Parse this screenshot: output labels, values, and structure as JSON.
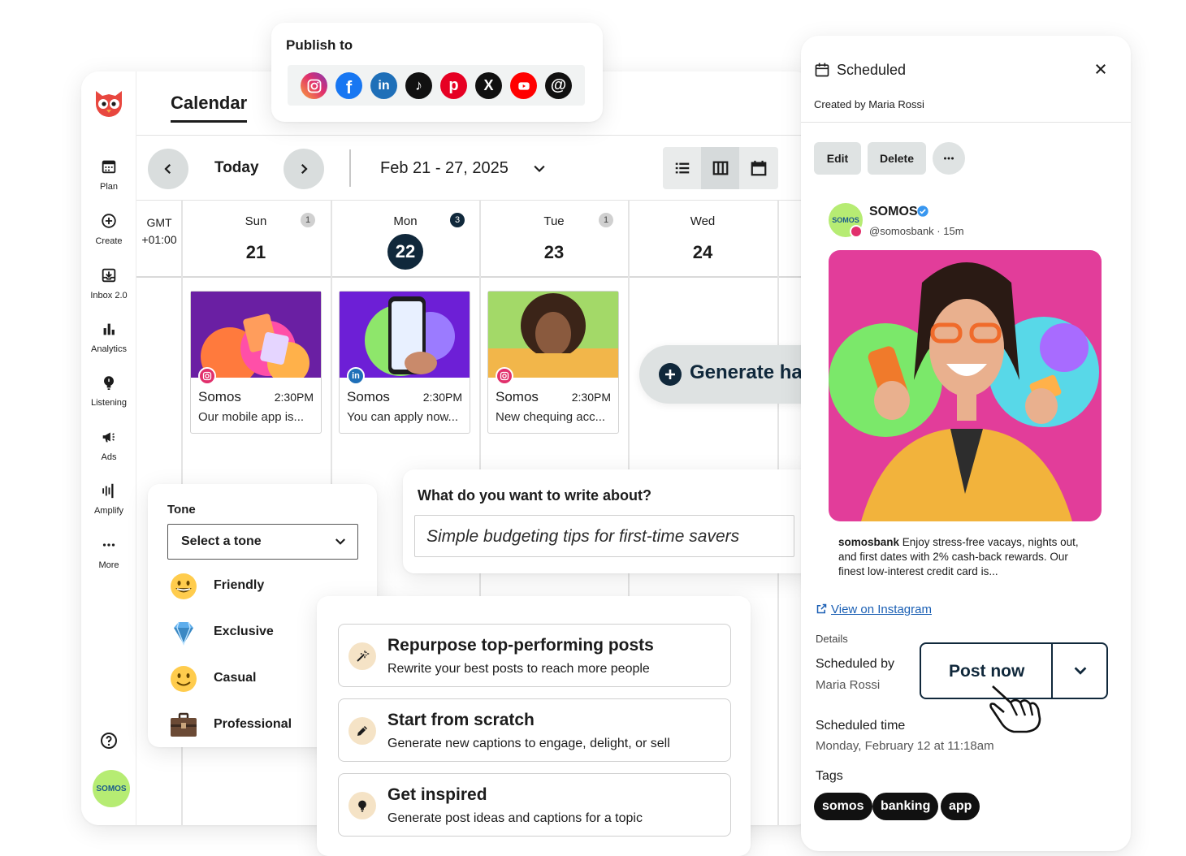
{
  "app": {
    "sidebar": {
      "items": [
        {
          "label": "Plan",
          "icon": "calendar-icon"
        },
        {
          "label": "Create",
          "icon": "plus-circle-icon"
        },
        {
          "label": "Inbox 2.0",
          "icon": "inbox-icon"
        },
        {
          "label": "Analytics",
          "icon": "bar-chart-icon"
        },
        {
          "label": "Listening",
          "icon": "lightbulb-icon"
        },
        {
          "label": "Ads",
          "icon": "megaphone-icon"
        },
        {
          "label": "Amplify",
          "icon": "amplify-icon"
        },
        {
          "label": "More",
          "icon": "more-dots-icon"
        }
      ],
      "avatar_text": "SOMOS"
    },
    "calendar": {
      "title": "Calendar",
      "today_label": "Today",
      "date_range": "Feb 21 - 27, 2025",
      "timezone_line1": "GMT",
      "timezone_line2": "+01:00",
      "days": [
        {
          "name": "Sun",
          "num": "21",
          "count": "1"
        },
        {
          "name": "Mon",
          "num": "22",
          "count": "3"
        },
        {
          "name": "Tue",
          "num": "23",
          "count": "1"
        },
        {
          "name": "Wed",
          "num": "24",
          "count": ""
        }
      ],
      "posts": [
        {
          "name": "Somos",
          "time": "2:30PM",
          "text": "Our mobile app is...",
          "network": "instagram"
        },
        {
          "name": "Somos",
          "time": "2:30PM",
          "text": "You can apply now...",
          "network": "linkedin"
        },
        {
          "name": "Somos",
          "time": "2:30PM",
          "text": "New chequing acc...",
          "network": "instagram"
        }
      ]
    }
  },
  "publish": {
    "title": "Publish to",
    "networks": [
      "instagram-icon",
      "facebook-icon",
      "linkedin-icon",
      "tiktok-icon",
      "pinterest-icon",
      "x-icon",
      "youtube-icon",
      "threads-icon"
    ]
  },
  "hashtags": {
    "label": "Generate hashtags"
  },
  "tone": {
    "title": "Tone",
    "select_value": "Select a tone",
    "options": [
      "Friendly",
      "Exclusive",
      "Casual",
      "Professional"
    ]
  },
  "write": {
    "title": "What do you want to write about?",
    "value": "Simple budgeting tips for first-time savers"
  },
  "options": [
    {
      "title": "Repurpose top-performing posts",
      "desc": "Rewrite your best posts to reach more people"
    },
    {
      "title": "Start from scratch",
      "desc": "Generate new captions to engage, delight, or sell"
    },
    {
      "title": "Get inspired",
      "desc": "Generate post ideas and captions for a topic"
    }
  ],
  "scheduled": {
    "title": "Scheduled",
    "created_by": "Created by Maria Rossi",
    "edit": "Edit",
    "delete": "Delete",
    "account_avatar": "SOMOS",
    "account_name": "SOMOS",
    "account_handle": "@somosbank · 15m",
    "caption_user": "somosbank",
    "caption_text": " Enjoy stress-free vacays, nights out, and first dates with 2% cash-back rewards. Our finest low-interest credit card is...",
    "view_link": "View on Instagram",
    "details_label": "Details",
    "scheduled_by_label": "Scheduled by",
    "scheduled_by_value": "Maria Rossi",
    "post_now": "Post now",
    "scheduled_time_label": "Scheduled time",
    "scheduled_time_value": "Monday, February 12 at 11:18am",
    "tags_label": "Tags",
    "tags": [
      "somos",
      "banking",
      "app"
    ]
  },
  "colors": {
    "brand_dark": "#10283b",
    "owl_red": "#e8473f",
    "somos_green": "#b6ec73",
    "link_blue": "#1a5fb4",
    "image_pink": "#e23d9a"
  }
}
